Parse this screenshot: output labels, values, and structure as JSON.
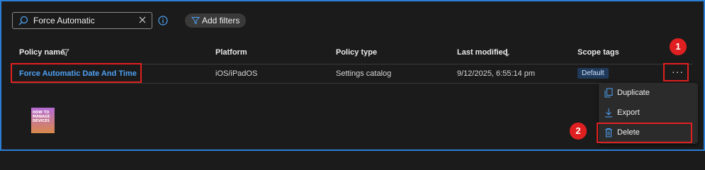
{
  "toolbar": {
    "search_value": "Force Automatic",
    "add_filters_label": "Add filters"
  },
  "table": {
    "columns": [
      "Policy name",
      "Platform",
      "Policy type",
      "Last modified",
      "Scope tags"
    ],
    "row": {
      "policy_name": "Force Automatic Date And Time",
      "platform": "iOS/iPadOS",
      "policy_type": "Settings catalog",
      "last_modified": "9/12/2025, 6:55:14 pm",
      "scope_tag": "Default",
      "more_label": "···"
    }
  },
  "context_menu": {
    "items": [
      "Duplicate",
      "Export",
      "Delete"
    ]
  },
  "annotations": [
    "1",
    "2"
  ],
  "logo": {
    "lines": [
      "HOW TO",
      "MANAGE",
      "DEVICES"
    ]
  },
  "colors": {
    "accent": "#2b7fd6",
    "link": "#4ea1f3",
    "highlight": "#e02020",
    "background": "#1b1b1b"
  },
  "icons": [
    "search-icon",
    "clear-icon",
    "info-icon",
    "filter-icon",
    "funnel-icon",
    "sort-down-icon",
    "duplicate-icon",
    "export-icon",
    "delete-icon"
  ]
}
